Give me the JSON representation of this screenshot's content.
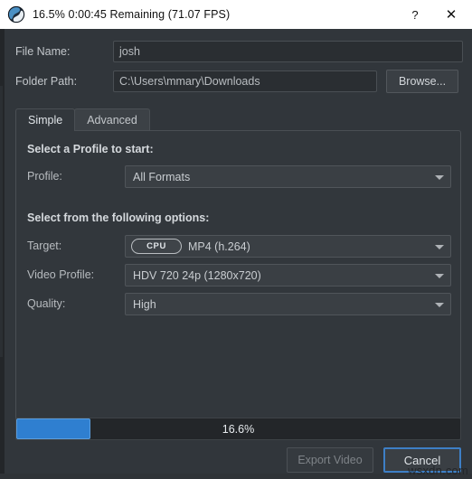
{
  "titlebar": {
    "icon": "openshot-globe-icon",
    "title": "16.5%  0:00:45 Remaining (71.07 FPS)",
    "help_label": "?",
    "close_label": "✕"
  },
  "form": {
    "file_name_label": "File Name:",
    "file_name_value": "josh",
    "folder_path_label": "Folder Path:",
    "folder_path_value": "C:\\Users\\mmary\\Downloads",
    "browse_label": "Browse..."
  },
  "tabs": [
    {
      "label": "Simple",
      "active": true
    },
    {
      "label": "Advanced",
      "active": false
    }
  ],
  "panel": {
    "profile_heading": "Select a Profile to start:",
    "profile_label": "Profile:",
    "profile_value": "All Formats",
    "options_heading": "Select from the following options:",
    "target_label": "Target:",
    "target_badge": "CPU",
    "target_value": "MP4 (h.264)",
    "video_profile_label": "Video Profile:",
    "video_profile_value": "HDV 720 24p (1280x720)",
    "quality_label": "Quality:",
    "quality_value": "High"
  },
  "progress": {
    "percent_text": "16.6%",
    "percent_value": 16.6,
    "fill_color": "#2f7fd0",
    "track_color": "#232629"
  },
  "footer": {
    "export_label": "Export Video",
    "cancel_label": "Cancel"
  },
  "watermark": {
    "text": "wsxdn.com"
  }
}
